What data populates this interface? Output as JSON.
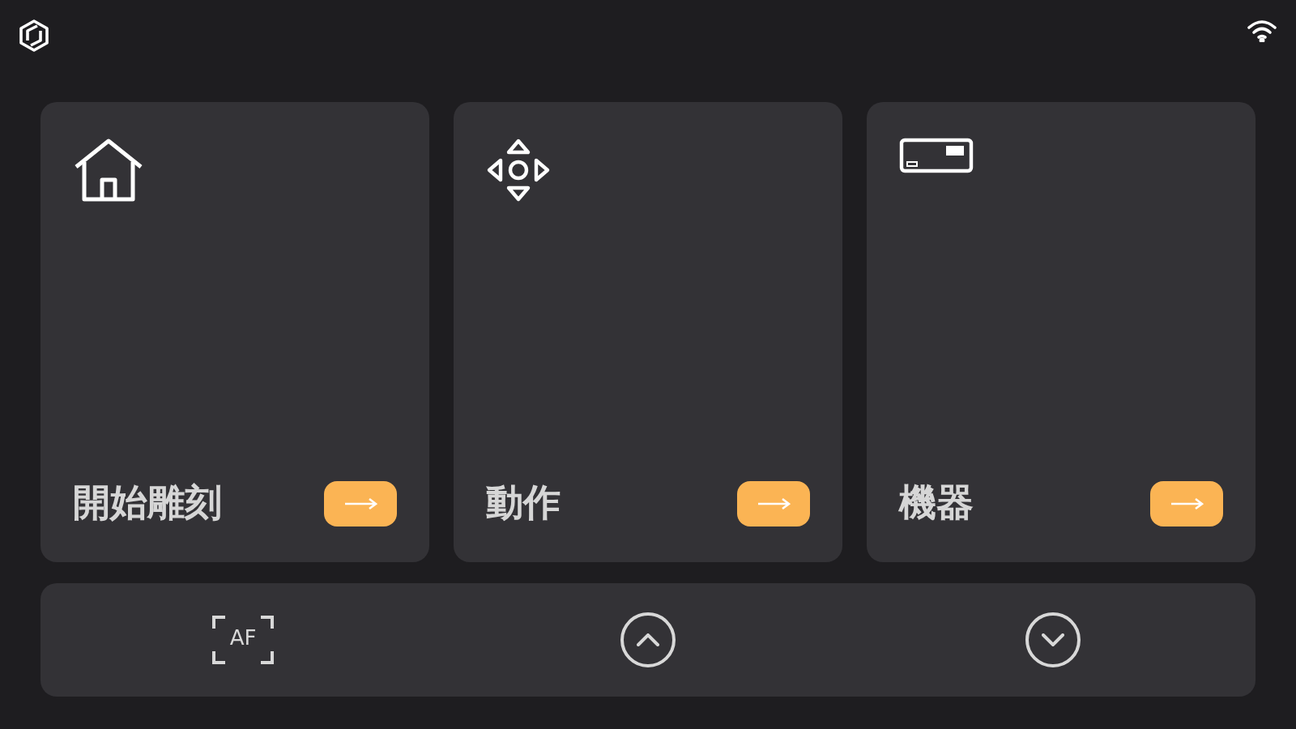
{
  "cards": [
    {
      "kind": "home",
      "label": "開始雕刻"
    },
    {
      "kind": "move",
      "label": "動作"
    },
    {
      "kind": "machine",
      "label": "機器"
    }
  ],
  "controls": [
    {
      "kind": "af",
      "label": "AF"
    },
    {
      "kind": "up"
    },
    {
      "kind": "down"
    }
  ]
}
